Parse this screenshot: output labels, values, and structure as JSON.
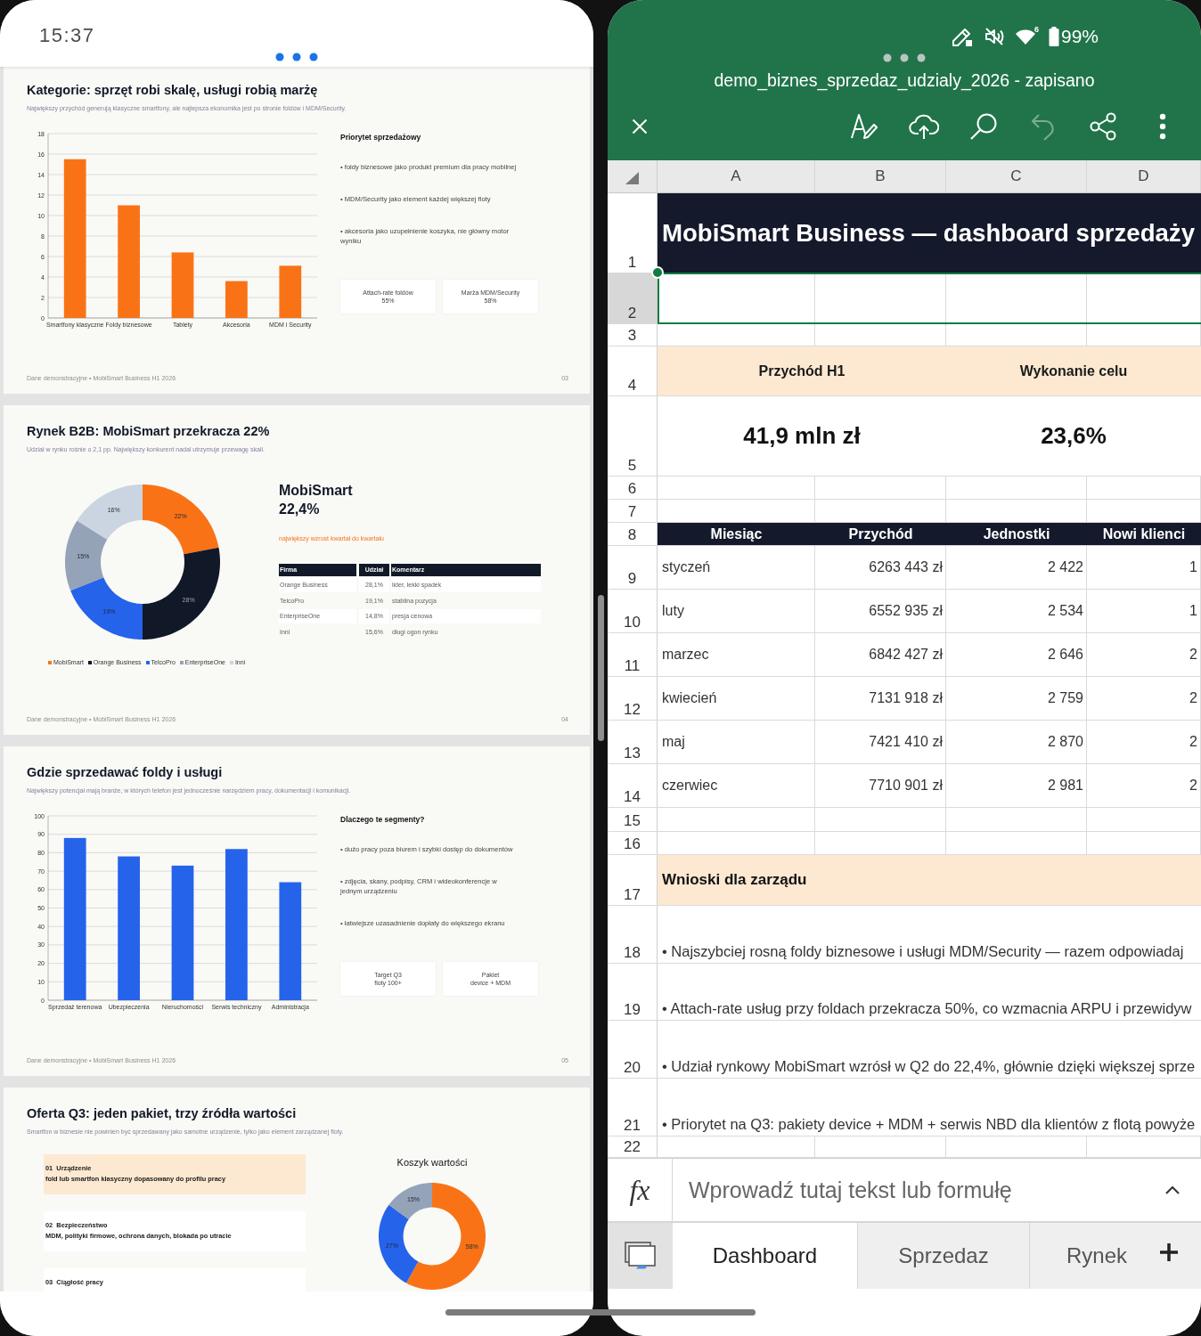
{
  "left_pane": {
    "status_bar": {
      "time": "15:37"
    },
    "slides": [
      {
        "kind": "bar_notes",
        "title": "Kategorie: sprzęt robi skalę, usługi robią marżę",
        "subtitle": "Największy przychód generują klasyczne smartfony, ale najlepsza ekonomika jest po stronie foldów i MDM/Security.",
        "chart_data": {
          "type": "bar",
          "categories": [
            "Smartfony klasyczne",
            "Foldy biznesowe",
            "Tablety",
            "Akcesoria",
            "MDM i Security"
          ],
          "series": [
            {
              "color": "#f97316",
              "values": [
                15.5,
                11,
                6.4,
                3.6,
                5.1
              ]
            }
          ],
          "ylim": [
            0,
            18
          ],
          "yticks": [
            0,
            2,
            4,
            6,
            8,
            10,
            12,
            14,
            16,
            18
          ],
          "grid": true
        },
        "notes_title": "Priorytet sprzedażowy",
        "bullets": [
          "• foldy biznesowe jako produkt premium dla pracy mobilnej",
          "• MDM/Security jako element każdej większej floty",
          "• akcesoria jako uzupełnienie koszyka, nie główny motor wyniku"
        ],
        "cards": [
          {
            "label": "Attach-rate foldów",
            "value": "55%"
          },
          {
            "label": "Marża MDM/Security",
            "value": "58%"
          }
        ],
        "footer": "Dane demonstracyjne • MobiSmart Business H1 2026",
        "page": "03"
      },
      {
        "kind": "share_donut",
        "title": "Rynek B2B: MobiSmart przekracza 22%",
        "subtitle": "Udział w rynku rośnie o 2,1 pp. Największy konkurent nadal utrzymuje przewagę skali.",
        "chart_data": {
          "type": "donut",
          "categories": [
            "MobiSmart",
            "Orange Business",
            "TelcoPro",
            "EnterpriseOne",
            "Inni"
          ],
          "values": [
            22,
            28,
            19,
            15,
            16
          ],
          "value_labels": [
            "22%",
            "28%",
            "19%",
            "15%",
            "16%"
          ]
        },
        "headline": "MobiSmart",
        "headline_value": "22,4%",
        "highlight": "największy wzrost kwartał do kwartału",
        "table": {
          "columns": [
            "Firma",
            "Udział",
            "Komentarz"
          ],
          "rows": [
            [
              "Orange Business",
              "28,1%",
              "lider, lekki spadek"
            ],
            [
              "TelcoPro",
              "19,1%",
              "stabilna pozycja"
            ],
            [
              "EnterpriseOne",
              "14,8%",
              "presja cenowa"
            ],
            [
              "Inni",
              "15,6%",
              "długi ogon rynku"
            ]
          ]
        },
        "footer": "Dane demonstracyjne • MobiSmart Business H1 2026",
        "page": "04"
      },
      {
        "kind": "bar_notes",
        "title": "Gdzie sprzedawać foldy i usługi",
        "subtitle": "Największy potencjał mają branże, w których telefon jest jednocześnie narzędziem pracy, dokumentacji i komunikacji.",
        "chart_data": {
          "type": "bar",
          "categories": [
            "Sprzedaż terenowa",
            "Ubezpieczenia",
            "Nieruchomości",
            "Serwis techniczny",
            "Administracja"
          ],
          "series": [
            {
              "color": "#2563eb",
              "values": [
                88,
                78,
                73,
                82,
                64
              ]
            }
          ],
          "ylim": [
            0,
            100
          ],
          "yticks": [
            0,
            10,
            20,
            30,
            40,
            50,
            60,
            70,
            80,
            90,
            100
          ],
          "grid": true
        },
        "notes_title": "Dlaczego te segmenty?",
        "bullets": [
          "• dużo pracy poza biurem i szybki dostęp do dokumentów",
          "• zdjęcia, skany, podpisy, CRM i wideokonferencje w jednym urządzeniu",
          "• łatwiejsze uzasadnienie dopłaty do większego ekranu"
        ],
        "cards": [
          {
            "label": "Target Q3",
            "value": "floty 100+"
          },
          {
            "label": "Pakiet",
            "value": "device + MDM"
          }
        ],
        "footer": "Dane demonstracyjne • MobiSmart Business H1 2026",
        "page": "05"
      },
      {
        "kind": "offer",
        "title": "Oferta Q3: jeden pakiet, trzy źródła wartości",
        "subtitle": "Smartfon w biznesie nie powinien być sprzedawany jako samotne urządzenie, tylko jako element zarządzanej floty.",
        "items": [
          {
            "number": "01",
            "name": "Urządzenie",
            "description": "fold lub smartfon klasyczny dopasowany do profilu pracy",
            "highlighted": true
          },
          {
            "number": "02",
            "name": "Bezpieczeństwo",
            "description": "MDM, polityki firmowe, ochrona danych, blokada po utracie",
            "highlighted": false
          },
          {
            "number": "03",
            "name": "Ciągłość pracy",
            "highlighted": false
          }
        ],
        "chart_data": {
          "type": "donut",
          "title": "Koszyk wartości",
          "values": [
            58,
            27,
            15
          ],
          "value_labels": [
            "58%",
            "27%",
            "15%"
          ]
        }
      }
    ]
  },
  "right_pane": {
    "status_bar": {
      "wifi_badge": "6",
      "battery": "99%"
    },
    "title": "demo_biznes_sprzedaz_udzialy_2026 - zapisano",
    "toolbar": {
      "undo": {
        "disabled": true
      }
    },
    "sheet": {
      "columns": [
        "A",
        "B",
        "C",
        "D"
      ],
      "rows": [
        {
          "number": "1",
          "kind": "title",
          "text": "MobiSmart Business — dashboard sprzedaży",
          "selected": false
        },
        {
          "number": "2",
          "kind": "blank",
          "selected": true
        },
        {
          "number": "3",
          "kind": "blank",
          "selected": false
        },
        {
          "number": "4",
          "kind": "kpi_label",
          "cells": [
            "Przychód H1",
            "Wykonanie celu"
          ],
          "selected": false
        },
        {
          "number": "5",
          "kind": "kpi_value",
          "cells": [
            "41,9 mln zł",
            "23,6%"
          ],
          "selected": false
        },
        {
          "number": "6",
          "kind": "blank",
          "selected": false
        },
        {
          "number": "7",
          "kind": "blank",
          "selected": false
        },
        {
          "number": "8",
          "kind": "header",
          "cells": [
            "Miesiąc",
            "Przychód",
            "Jednostki",
            "Nowi klienci"
          ],
          "selected": false
        },
        {
          "number": "9",
          "kind": "data",
          "cells": [
            "styczeń",
            "6263 443 zł",
            "2 422",
            "1"
          ],
          "selected": false
        },
        {
          "number": "10",
          "kind": "data",
          "cells": [
            "luty",
            "6552 935 zł",
            "2 534",
            "1"
          ],
          "selected": false
        },
        {
          "number": "11",
          "kind": "data",
          "cells": [
            "marzec",
            "6842 427 zł",
            "2 646",
            "2"
          ],
          "selected": false
        },
        {
          "number": "12",
          "kind": "data",
          "cells": [
            "kwiecień",
            "7131 918 zł",
            "2 759",
            "2"
          ],
          "selected": false
        },
        {
          "number": "13",
          "kind": "data",
          "cells": [
            "maj",
            "7421 410 zł",
            "2 870",
            "2"
          ],
          "selected": false
        },
        {
          "number": "14",
          "kind": "data",
          "cells": [
            "czerwiec",
            "7710 901 zł",
            "2 981",
            "2"
          ],
          "selected": false
        },
        {
          "number": "15",
          "kind": "blank",
          "selected": false
        },
        {
          "number": "16",
          "kind": "blank",
          "selected": false
        },
        {
          "number": "17",
          "kind": "section",
          "text": "Wnioski dla zarządu",
          "selected": false
        },
        {
          "number": "18",
          "kind": "note",
          "text": "• Najszybciej rosną foldy biznesowe i usługi MDM/Security — razem odpowiadaj",
          "selected": false
        },
        {
          "number": "19",
          "kind": "note",
          "text": "• Attach-rate usług przy foldach przekracza 50%, co wzmacnia ARPU i przewidyw",
          "selected": false
        },
        {
          "number": "20",
          "kind": "note",
          "text": "• Udział rynkowy MobiSmart wzrósł w Q2 do 22,4%, głównie dzięki większej sprze",
          "selected": false
        },
        {
          "number": "21",
          "kind": "note",
          "text": "• Priorytet na Q3: pakiety device + MDM + serwis NBD dla klientów z flotą powyże",
          "selected": false
        },
        {
          "number": "22",
          "kind": "blank",
          "selected": false
        }
      ]
    },
    "formula_bar": {
      "function_label": "fx",
      "placeholder": "Wprowadź tutaj tekst lub formułę"
    },
    "sheet_tabs": [
      {
        "label": "Dashboard",
        "selected": true
      },
      {
        "label": "Sprzedaz",
        "selected": false
      },
      {
        "label": "Rynek",
        "selected": false
      }
    ]
  }
}
